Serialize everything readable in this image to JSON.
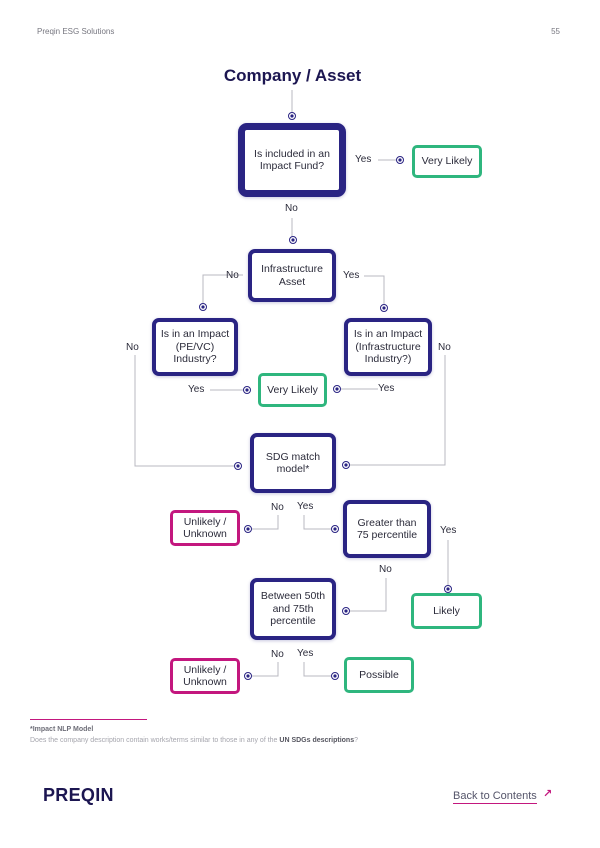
{
  "header": {
    "left": "Preqin ESG Solutions",
    "page_number": "55"
  },
  "diagram": {
    "title": "Company / Asset",
    "nodes": {
      "impact_fund": "Is included in an Impact Fund?",
      "very_likely_1": "Very Likely",
      "infrastructure": "Infrastructure Asset",
      "pevc_industry": "Is in an Impact (PE/VC) Industry?",
      "infra_industry": "Is in an Impact (Infrastructure Industry?)",
      "very_likely_2": "Very Likely",
      "sdg_model": "SDG match model*",
      "unlikely_1": "Unlikely / Unknown",
      "gt75": "Greater than 75 percentile",
      "between": "Between 50th and 75th percentile",
      "likely": "Likely",
      "unlikely_2": "Unlikely / Unknown",
      "possible": "Possible"
    },
    "edge_labels": {
      "fund_yes": "Yes",
      "fund_no": "No",
      "infra_no": "No",
      "infra_yes": "Yes",
      "pevc_no": "No",
      "pevc_yes": "Yes",
      "infraind_no": "No",
      "infraind_yes": "Yes",
      "sdg_no": "No",
      "sdg_yes": "Yes",
      "gt75_yes": "Yes",
      "gt75_no": "No",
      "between_no": "No",
      "between_yes": "Yes"
    },
    "colors": {
      "question": "#2a2483",
      "positive": "#2fb67e",
      "negative": "#c3177e",
      "connector": "#b8b8c0"
    }
  },
  "footnote": {
    "title": "*Impact NLP Model",
    "text_prefix": "Does the company description contain works/terms similar to those in any of the ",
    "text_bold": "UN SDGs descriptions",
    "text_suffix": "?"
  },
  "footer": {
    "logo": "PREQIN",
    "back_link": "Back to Contents",
    "back_icon": "arrow-up-right-icon"
  }
}
